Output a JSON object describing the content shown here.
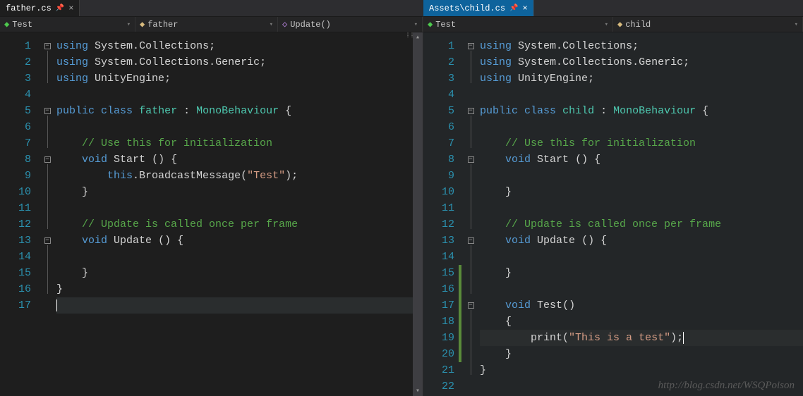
{
  "left": {
    "tab": {
      "label": "father.cs"
    },
    "nav": {
      "ns": "Test",
      "cls": "father",
      "member": "Update()"
    },
    "lines": [
      {
        "n": 1,
        "fold": "box",
        "tokens": [
          [
            "kw",
            "using"
          ],
          [
            "pn",
            " "
          ],
          [
            "id",
            "System"
          ],
          [
            "pn",
            "."
          ],
          [
            "id",
            "Collections"
          ],
          [
            "pn",
            ";"
          ]
        ]
      },
      {
        "n": 2,
        "fold": "line",
        "tokens": [
          [
            "kw",
            "using"
          ],
          [
            "pn",
            " "
          ],
          [
            "id",
            "System"
          ],
          [
            "pn",
            "."
          ],
          [
            "id",
            "Collections"
          ],
          [
            "pn",
            "."
          ],
          [
            "id",
            "Generic"
          ],
          [
            "pn",
            ";"
          ]
        ]
      },
      {
        "n": 3,
        "fold": "line",
        "tokens": [
          [
            "kw",
            "using"
          ],
          [
            "pn",
            " "
          ],
          [
            "id",
            "UnityEngine"
          ],
          [
            "pn",
            ";"
          ]
        ]
      },
      {
        "n": 4,
        "fold": "",
        "tokens": []
      },
      {
        "n": 5,
        "fold": "box",
        "tokens": [
          [
            "kw",
            "public"
          ],
          [
            "pn",
            " "
          ],
          [
            "kw",
            "class"
          ],
          [
            "pn",
            " "
          ],
          [
            "type",
            "father"
          ],
          [
            "pn",
            " : "
          ],
          [
            "type",
            "MonoBehaviour"
          ],
          [
            "pn",
            " {"
          ]
        ]
      },
      {
        "n": 6,
        "fold": "line",
        "tokens": []
      },
      {
        "n": 7,
        "fold": "line",
        "tokens": [
          [
            "pn",
            "    "
          ],
          [
            "cm",
            "// Use this for initialization"
          ]
        ]
      },
      {
        "n": 8,
        "fold": "box",
        "tokens": [
          [
            "pn",
            "    "
          ],
          [
            "kw",
            "void"
          ],
          [
            "pn",
            " "
          ],
          [
            "id",
            "Start"
          ],
          [
            "pn",
            " () {"
          ]
        ]
      },
      {
        "n": 9,
        "fold": "line",
        "tokens": [
          [
            "pn",
            "        "
          ],
          [
            "kw",
            "this"
          ],
          [
            "pn",
            "."
          ],
          [
            "id",
            "BroadcastMessage"
          ],
          [
            "pn",
            "("
          ],
          [
            "str",
            "\"Test\""
          ],
          [
            "pn",
            ");"
          ]
        ]
      },
      {
        "n": 10,
        "fold": "line",
        "tokens": [
          [
            "pn",
            "    }"
          ]
        ]
      },
      {
        "n": 11,
        "fold": "line",
        "tokens": []
      },
      {
        "n": 12,
        "fold": "line",
        "tokens": [
          [
            "pn",
            "    "
          ],
          [
            "cm",
            "// Update is called once per frame"
          ]
        ]
      },
      {
        "n": 13,
        "fold": "box",
        "tokens": [
          [
            "pn",
            "    "
          ],
          [
            "kw",
            "void"
          ],
          [
            "pn",
            " "
          ],
          [
            "id",
            "Update"
          ],
          [
            "pn",
            " () {"
          ]
        ]
      },
      {
        "n": 14,
        "fold": "line",
        "tokens": []
      },
      {
        "n": 15,
        "fold": "line",
        "tokens": [
          [
            "pn",
            "    }"
          ]
        ]
      },
      {
        "n": 16,
        "fold": "line",
        "tokens": [
          [
            "pn",
            "}"
          ]
        ]
      },
      {
        "n": 17,
        "fold": "",
        "cursor": true,
        "tokens": []
      }
    ]
  },
  "right": {
    "tab": {
      "label": "Assets\\child.cs"
    },
    "nav": {
      "ns": "Test",
      "cls": "child"
    },
    "lines": [
      {
        "n": 1,
        "fold": "box",
        "tokens": [
          [
            "kw",
            "using"
          ],
          [
            "pn",
            " "
          ],
          [
            "id",
            "System"
          ],
          [
            "pn",
            "."
          ],
          [
            "id",
            "Collections"
          ],
          [
            "pn",
            ";"
          ]
        ]
      },
      {
        "n": 2,
        "fold": "line",
        "tokens": [
          [
            "kw",
            "using"
          ],
          [
            "pn",
            " "
          ],
          [
            "id",
            "System"
          ],
          [
            "pn",
            "."
          ],
          [
            "id",
            "Collections"
          ],
          [
            "pn",
            "."
          ],
          [
            "id",
            "Generic"
          ],
          [
            "pn",
            ";"
          ]
        ]
      },
      {
        "n": 3,
        "fold": "line",
        "tokens": [
          [
            "kw",
            "using"
          ],
          [
            "pn",
            " "
          ],
          [
            "id",
            "UnityEngine"
          ],
          [
            "pn",
            ";"
          ]
        ]
      },
      {
        "n": 4,
        "fold": "",
        "tokens": []
      },
      {
        "n": 5,
        "fold": "box",
        "tokens": [
          [
            "kw",
            "public"
          ],
          [
            "pn",
            " "
          ],
          [
            "kw",
            "class"
          ],
          [
            "pn",
            " "
          ],
          [
            "type",
            "child"
          ],
          [
            "pn",
            " : "
          ],
          [
            "type",
            "MonoBehaviour"
          ],
          [
            "pn",
            " {"
          ]
        ]
      },
      {
        "n": 6,
        "fold": "line",
        "tokens": []
      },
      {
        "n": 7,
        "fold": "line",
        "tokens": [
          [
            "pn",
            "    "
          ],
          [
            "cm",
            "// Use this for initialization"
          ]
        ]
      },
      {
        "n": 8,
        "fold": "box",
        "tokens": [
          [
            "pn",
            "    "
          ],
          [
            "kw",
            "void"
          ],
          [
            "pn",
            " "
          ],
          [
            "id",
            "Start"
          ],
          [
            "pn",
            " () {"
          ]
        ]
      },
      {
        "n": 9,
        "fold": "line",
        "tokens": []
      },
      {
        "n": 10,
        "fold": "line",
        "tokens": [
          [
            "pn",
            "    }"
          ]
        ]
      },
      {
        "n": 11,
        "fold": "line",
        "tokens": []
      },
      {
        "n": 12,
        "fold": "line",
        "tokens": [
          [
            "pn",
            "    "
          ],
          [
            "cm",
            "// Update is called once per frame"
          ]
        ]
      },
      {
        "n": 13,
        "fold": "box",
        "tokens": [
          [
            "pn",
            "    "
          ],
          [
            "kw",
            "void"
          ],
          [
            "pn",
            " "
          ],
          [
            "id",
            "Update"
          ],
          [
            "pn",
            " () {"
          ]
        ]
      },
      {
        "n": 14,
        "fold": "line",
        "tokens": []
      },
      {
        "n": 15,
        "fold": "line",
        "mod": true,
        "tokens": [
          [
            "pn",
            "    }"
          ]
        ]
      },
      {
        "n": 16,
        "fold": "line",
        "mod": true,
        "tokens": []
      },
      {
        "n": 17,
        "fold": "box",
        "mod": true,
        "tokens": [
          [
            "pn",
            "    "
          ],
          [
            "kw",
            "void"
          ],
          [
            "pn",
            " "
          ],
          [
            "id",
            "Test"
          ],
          [
            "pn",
            "()"
          ]
        ]
      },
      {
        "n": 18,
        "fold": "line",
        "mod": true,
        "tokens": [
          [
            "pn",
            "    {"
          ]
        ]
      },
      {
        "n": 19,
        "fold": "line",
        "mod": true,
        "cursor": true,
        "tokens": [
          [
            "pn",
            "        "
          ],
          [
            "id",
            "print"
          ],
          [
            "pn",
            "("
          ],
          [
            "str",
            "\"This is a test\""
          ],
          [
            "pn",
            ");"
          ]
        ]
      },
      {
        "n": 20,
        "fold": "line",
        "mod": true,
        "tokens": [
          [
            "pn",
            "    }"
          ]
        ]
      },
      {
        "n": 21,
        "fold": "line",
        "tokens": [
          [
            "pn",
            "}"
          ]
        ]
      },
      {
        "n": 22,
        "fold": "",
        "tokens": []
      }
    ]
  },
  "watermark": "http://blog.csdn.net/WSQPoison"
}
